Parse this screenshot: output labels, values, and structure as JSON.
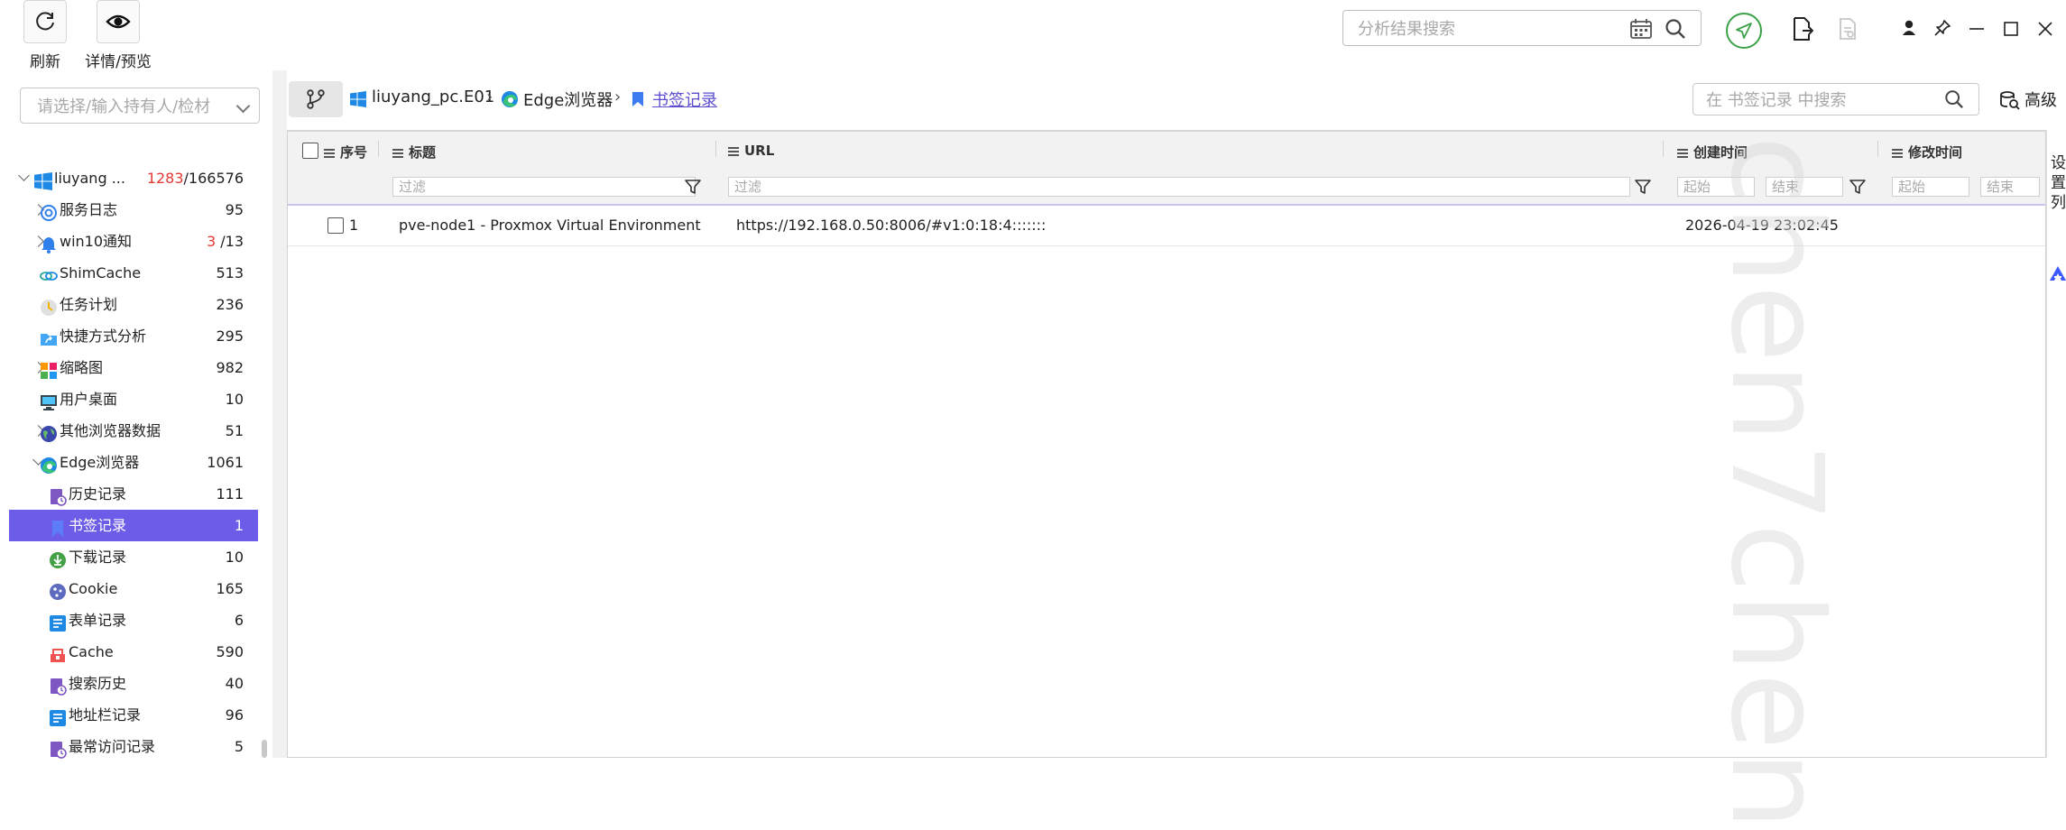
{
  "toolbar": {
    "refresh_label": "刷新",
    "detail_label": "详情/预览",
    "search_placeholder": "分析结果搜索"
  },
  "left": {
    "holder_placeholder": "请选择/输入持有人/检材",
    "tree": [
      {
        "label": "liuyang ...",
        "count_highlight": "1283",
        "count_rest": "/166576",
        "icon": "windows-icon",
        "expand": "down"
      },
      {
        "label": "服务日志",
        "count": "95",
        "icon": "service-log-icon",
        "expand": "right"
      },
      {
        "label": "win10通知",
        "count_highlight": "3",
        "count_rest": " /13",
        "icon": "notification-bell-icon",
        "expand": "right"
      },
      {
        "label": "ShimCache",
        "count": "513",
        "icon": "shimcache-icon",
        "expand": ""
      },
      {
        "label": "任务计划",
        "count": "236",
        "icon": "task-schedule-icon",
        "expand": ""
      },
      {
        "label": "快捷方式分析",
        "count": "295",
        "icon": "shortcut-folder-icon",
        "expand": ""
      },
      {
        "label": "缩略图",
        "count": "982",
        "icon": "thumbnail-icon",
        "expand": "right"
      },
      {
        "label": "用户桌面",
        "count": "10",
        "icon": "desktop-monitor-icon",
        "expand": ""
      },
      {
        "label": "其他浏览器数据",
        "count": "51",
        "icon": "globe-icon",
        "expand": "right"
      },
      {
        "label": "Edge浏览器",
        "count": "1061",
        "icon": "edge-browser-icon",
        "expand": "down"
      },
      {
        "label": "历史记录",
        "count": "111",
        "icon": "history-record-icon",
        "expand": ""
      },
      {
        "label": "书签记录",
        "count": "1",
        "icon": "bookmark-icon",
        "expand": "",
        "selected": true
      },
      {
        "label": "下载记录",
        "count": "10",
        "icon": "download-icon",
        "expand": ""
      },
      {
        "label": "Cookie",
        "count": "165",
        "icon": "cookie-icon",
        "expand": ""
      },
      {
        "label": "表单记录",
        "count": "6",
        "icon": "form-record-icon",
        "expand": ""
      },
      {
        "label": "Cache",
        "count": "590",
        "icon": "cache-icon",
        "expand": ""
      },
      {
        "label": "搜索历史",
        "count": "40",
        "icon": "search-history-icon",
        "expand": ""
      },
      {
        "label": "地址栏记录",
        "count": "96",
        "icon": "address-bar-icon",
        "expand": ""
      },
      {
        "label": "最常访问记录",
        "count": "5",
        "icon": "most-visited-icon",
        "expand": ""
      }
    ]
  },
  "breadcrumb": {
    "items": [
      "liuyang_pc.E01",
      "Edge浏览器",
      "书签记录"
    ],
    "search_placeholder": "在 书签记录 中搜索",
    "advanced_label": "高级"
  },
  "table": {
    "columns": [
      "序号",
      "标题",
      "URL",
      "创建时间",
      "修改时间"
    ],
    "filter_placeholder": "过滤",
    "date_start_placeholder": "起始",
    "date_end_placeholder": "结束",
    "rows": [
      {
        "index": "1",
        "title": "pve-node1 - Proxmox Virtual Environment",
        "url": "https://192.168.0.50:8006/#v1:0:18:4:::::::",
        "created": "2026-04-19 23:02:45",
        "modified": ""
      }
    ]
  },
  "side_panel": {
    "label": "设置列"
  },
  "watermark": "chen7chen",
  "colors": {
    "accent": "#6c5ce7",
    "highlight_count": "#e53935",
    "send_green": "#3ca24a"
  }
}
